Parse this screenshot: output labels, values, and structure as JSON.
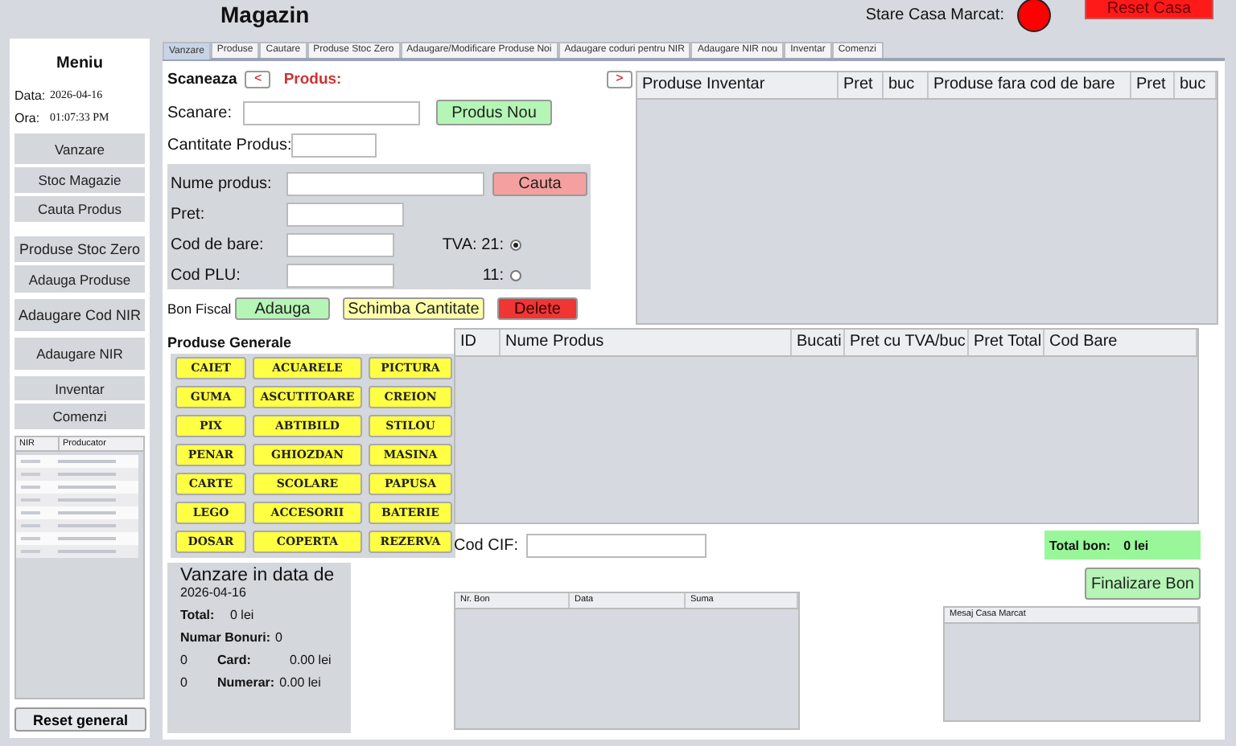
{
  "app": {
    "title": "Magazin"
  },
  "status": {
    "label": "Stare Casa Marcat:",
    "color": "#ff0000"
  },
  "reset_button": "Reset Casa",
  "menu": {
    "title": "Meniu",
    "date_label": "Data:",
    "date": "2026-04-16",
    "time_label": "Ora:",
    "time": "01:07:33 PM",
    "items": [
      "Vanzare",
      "Stoc Magazie",
      "Cauta Produs",
      "Produse Stoc Zero",
      "Adauga Produse",
      "Adaugare Cod NIR",
      "Adaugare NIR",
      "Inventar",
      "Comenzi"
    ],
    "nir_table": {
      "columns": [
        "NIR",
        "Producator"
      ]
    },
    "reset": "Reset general"
  },
  "tabs": [
    {
      "label": "Vanzare",
      "selected": true
    },
    {
      "label": "Produse",
      "selected": false
    },
    {
      "label": "Cautare",
      "selected": false
    },
    {
      "label": "Produse Stoc Zero",
      "selected": false
    },
    {
      "label": "Adaugare/Modificare Produse Noi",
      "selected": false
    },
    {
      "label": "Adaugare coduri pentru NIR",
      "selected": false
    },
    {
      "label": "Adaugare NIR nou",
      "selected": false
    },
    {
      "label": "Inventar",
      "selected": false
    },
    {
      "label": "Comenzi",
      "selected": false
    }
  ],
  "scan": {
    "label": "Scaneaza",
    "prev": "<",
    "product_label": "Produs:",
    "next": ">",
    "scan_label": "Scanare:",
    "new_product": "Produs Nou",
    "qty_label": "Cantitate Produs:"
  },
  "product_form": {
    "name_label": "Nume produs:",
    "search": "Cauta",
    "price_label": "Pret:",
    "barcode_label": "Cod de bare:",
    "plu_label": "Cod PLU:",
    "vat": [
      {
        "label": "TVA: 21:",
        "selected": true
      },
      {
        "label": "11:",
        "selected": false
      }
    ]
  },
  "bon_actions": {
    "label": "Bon Fiscal",
    "buttons": [
      {
        "label": "Adauga",
        "kind": "add"
      },
      {
        "label": "Schimba Cantitate",
        "kind": "change"
      },
      {
        "label": "Delete",
        "kind": "delete"
      }
    ]
  },
  "inventory_table": {
    "columns": [
      "Produse Inventar",
      "Pret",
      "buc",
      "Produse fara cod de bare",
      "Pret",
      "buc"
    ]
  },
  "general_products": {
    "title": "Produse Generale",
    "items": [
      "CAIET",
      "ACUARELE",
      "PICTURA",
      "GUMA",
      "ASCUTITOARE",
      "CREION",
      "PIX",
      "ABTIBILD",
      "STILOU",
      "PENAR",
      "GHIOZDAN",
      "MASINA",
      "CARTE",
      "SCOLARE",
      "PAPUSA",
      "LEGO",
      "ACCESORII",
      "BATERIE",
      "DOSAR",
      "COPERTA",
      "REZERVA"
    ]
  },
  "cart_table": {
    "columns": [
      "ID",
      "Nume Produs",
      "Bucati",
      "Pret cu TVA/buc",
      "Pret Total",
      "Cod Bare"
    ]
  },
  "cif": {
    "label": "Cod CIF:"
  },
  "total": {
    "label": "Total bon:",
    "value": "0 lei"
  },
  "finalize": "Finalizare Bon",
  "receipts_table": {
    "columns": [
      "Nr. Bon",
      "Data",
      "Suma"
    ]
  },
  "message_panel": {
    "title": "Mesaj Casa Marcat"
  },
  "sales_summary": {
    "title": "Vanzare in data de",
    "date": "2026-04-16",
    "total_label": "Total:",
    "total": "0 lei",
    "count_label": "Numar Bonuri:",
    "count": "0",
    "card_count": "0",
    "card_label": "Card:",
    "card": "0.00 lei",
    "cash_count": "0",
    "cash_label": "Numerar:",
    "cash": "0.00 lei"
  }
}
